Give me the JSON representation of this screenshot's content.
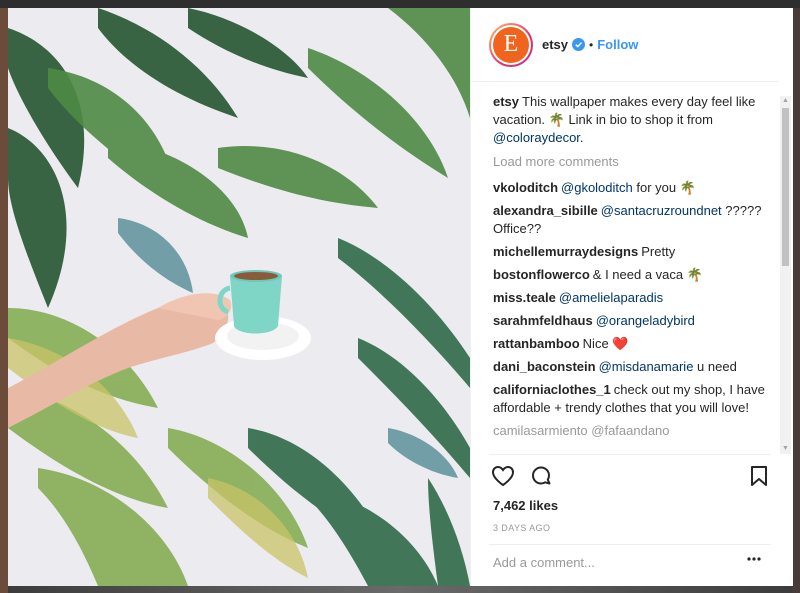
{
  "post": {
    "author": "etsy",
    "avatar_letter": "E",
    "dot": "•",
    "follow_label": "Follow",
    "caption": {
      "user": "etsy",
      "text_before": "This wallpaper makes every day feel like vacation. 🌴 Link in bio to shop it from ",
      "mention": "@coloraydecor",
      "text_after": "."
    },
    "load_more": "Load more comments",
    "comments": [
      {
        "user": "vkoloditch",
        "mention": "@gkoloditch",
        "text": " for you 🌴"
      },
      {
        "user": "alexandra_sibille",
        "mention": "@santacruzroundnet",
        "text": " ????? Office??"
      },
      {
        "user": "michellemurraydesigns",
        "mention": "",
        "text": "Pretty"
      },
      {
        "user": "bostonflowerco",
        "mention": "",
        "text": "& I need a vaca 🌴"
      },
      {
        "user": "miss.teale",
        "mention": "@amelielaparadis",
        "text": ""
      },
      {
        "user": "sarahmfeldhaus",
        "mention": "@orangeladybird",
        "text": ""
      },
      {
        "user": "rattanbamboo",
        "mention": "",
        "text": "Nice ❤️"
      },
      {
        "user": "dani_baconstein",
        "mention": "@misdanamarie",
        "text": " u need"
      },
      {
        "user": "californiaclothes_1",
        "mention": "",
        "text": "check out my shop, I have affordable + trendy clothes that you will love!"
      }
    ],
    "partial_comment": "camilasarmiento @fafaandano",
    "likes": "7,462 likes",
    "timestamp": "3 DAYS AGO",
    "add_comment_placeholder": "Add a comment...",
    "more_dots": "•••"
  },
  "icons": {
    "like": "heart-icon",
    "comment": "comment-bubble-icon",
    "save": "bookmark-icon",
    "verified": "verified-badge-icon",
    "scroll_up": "▲",
    "scroll_down": "▼"
  },
  "colors": {
    "brand_link": "#3897f0",
    "mention": "#003569",
    "avatar_bg": "#f1641e"
  }
}
